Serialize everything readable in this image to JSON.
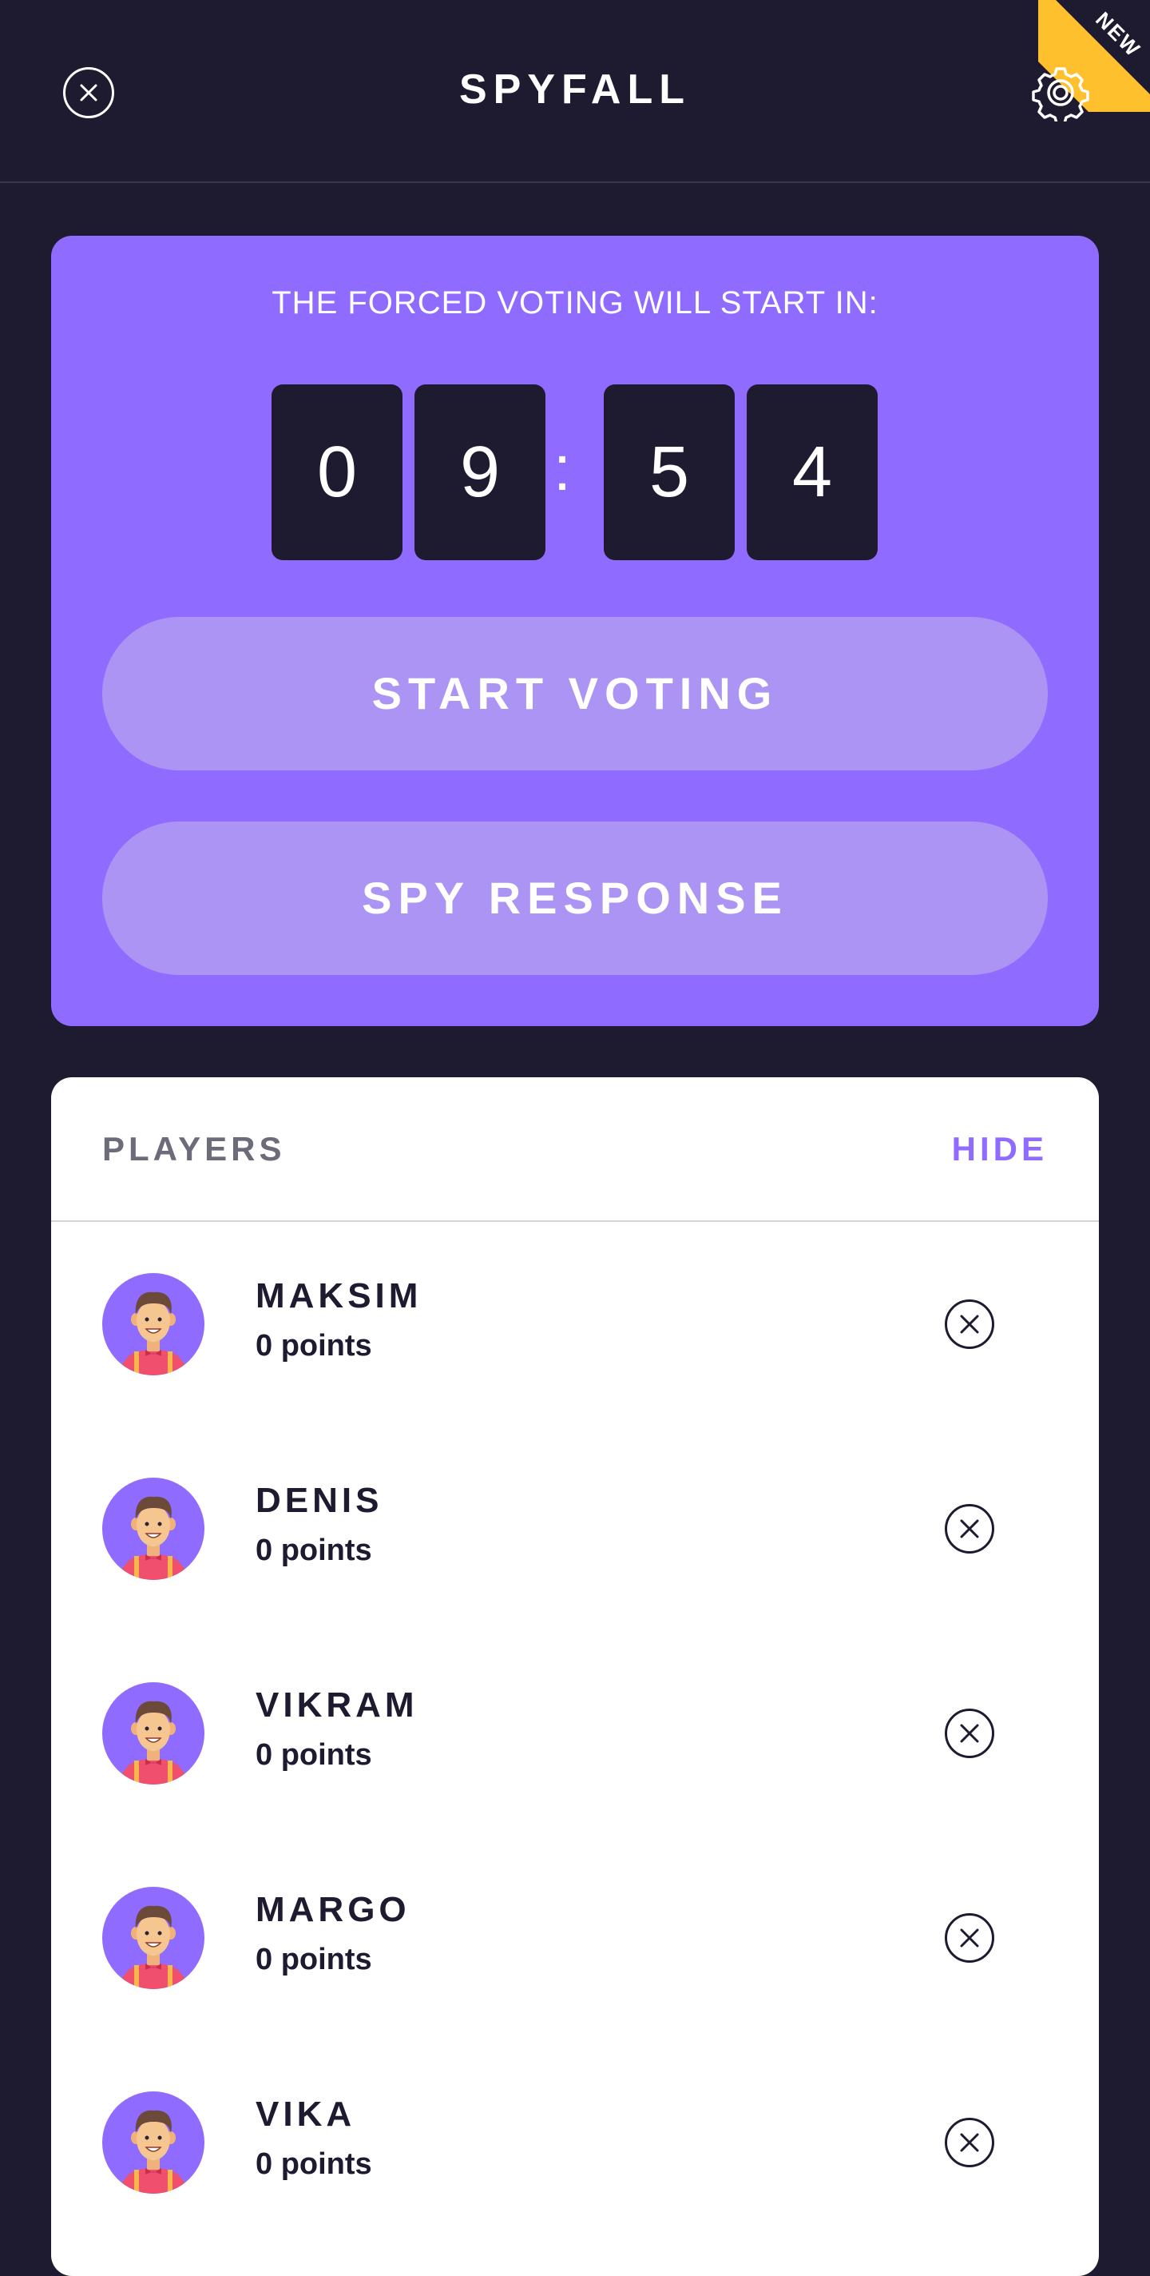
{
  "header": {
    "title": "SPYFALL",
    "close_icon": "close-circle-icon",
    "settings_icon": "gear-icon",
    "badge": "NEW"
  },
  "timer": {
    "caption": "THE FORCED VOTING WILL START IN:",
    "digits": [
      "0",
      "9",
      "5",
      "4"
    ],
    "separator": ":"
  },
  "actions": {
    "start_voting": "START VOTING",
    "spy_response": "SPY RESPONSE"
  },
  "players": {
    "title": "PLAYERS",
    "toggle": "HIDE",
    "items": [
      {
        "name": "MAKSIM",
        "points": "0 points"
      },
      {
        "name": "DENIS",
        "points": "0 points"
      },
      {
        "name": "VIKRAM",
        "points": "0 points"
      },
      {
        "name": "MARGO",
        "points": "0 points"
      },
      {
        "name": "VIKA",
        "points": "0 points"
      }
    ]
  },
  "colors": {
    "background": "#1e1a30",
    "accent": "#8f6cff",
    "button": "#ac94f4",
    "badge": "#ffc02e"
  }
}
